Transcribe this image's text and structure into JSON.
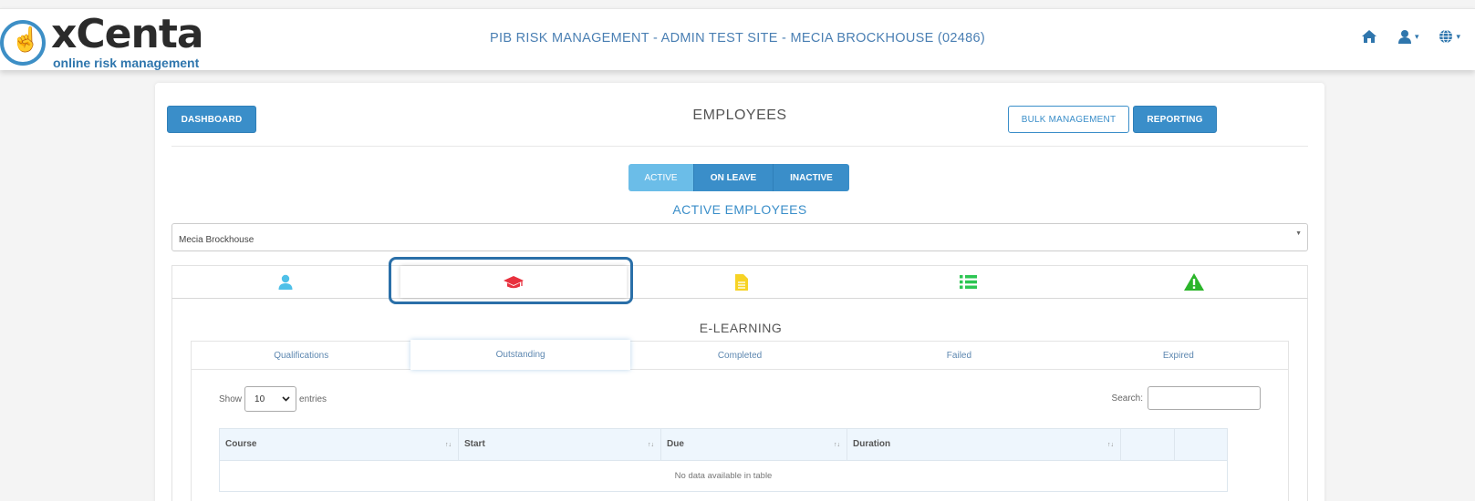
{
  "header": {
    "logo_name": "xCenta",
    "logo_subtitle": "online risk management",
    "site_title": "PIB RISK MANAGEMENT - ADMIN TEST SITE - MECIA BROCKHOUSE (02486)",
    "nav_icons": [
      "home-icon",
      "user-icon",
      "globe-icon"
    ]
  },
  "page": {
    "dashboard_label": "DASHBOARD",
    "title": "EMPLOYEES",
    "bulk_label": "BULK MANAGEMENT",
    "reporting_label": "REPORTING"
  },
  "status_tabs": [
    {
      "label": "ACTIVE",
      "active": true
    },
    {
      "label": "ON LEAVE",
      "active": false
    },
    {
      "label": "INACTIVE",
      "active": false
    }
  ],
  "section_title": "ACTIVE EMPLOYEES",
  "employee_select": {
    "value": "Mecia Brockhouse"
  },
  "icon_tabs": [
    {
      "icon": "user-icon",
      "color": "#4fc0e8"
    },
    {
      "icon": "graduation-cap-icon",
      "color": "#e8313e",
      "active": true
    },
    {
      "icon": "document-icon",
      "color": "#f7d325"
    },
    {
      "icon": "list-icon",
      "color": "#2dc653"
    },
    {
      "icon": "warning-icon",
      "color": "#2bb52a"
    }
  ],
  "elearning": {
    "title": "E-LEARNING",
    "tabs": [
      "Qualifications",
      "Outstanding",
      "Completed",
      "Failed",
      "Expired"
    ],
    "active_tab": "Outstanding"
  },
  "table": {
    "show_label": "Show",
    "entries_value": "10",
    "entries_label": "entries",
    "search_label": "Search:",
    "columns": [
      "Course",
      "Start",
      "Due",
      "Duration",
      "",
      ""
    ],
    "empty_message": "No data available in table"
  },
  "colors": {
    "primary": "#3a8ec9",
    "active_segment": "#6bbde8",
    "highlight_border": "#2a6fa8"
  }
}
